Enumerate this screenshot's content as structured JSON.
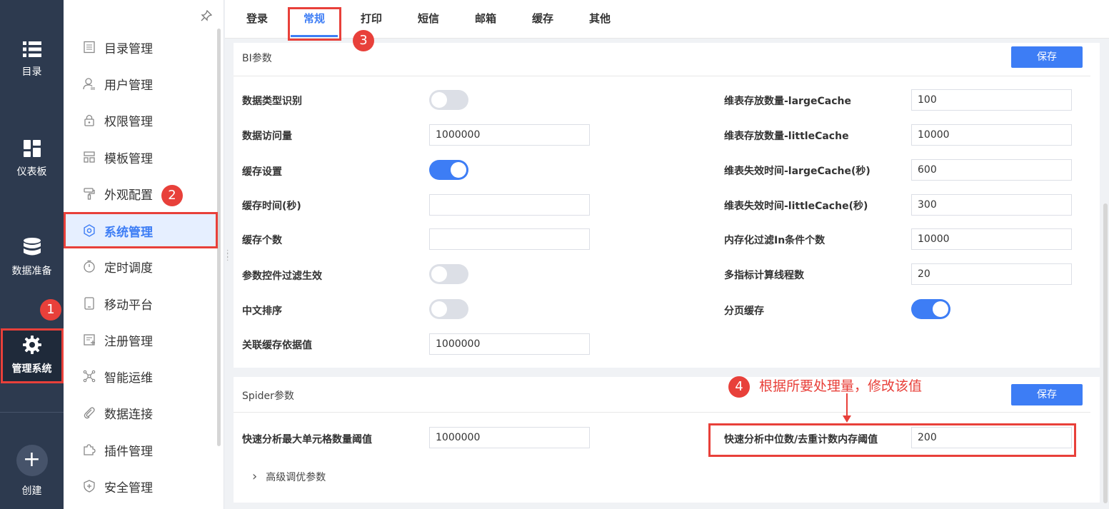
{
  "rail": {
    "items": [
      {
        "label": "目录",
        "icon": "list-icon"
      },
      {
        "label": "仪表板",
        "icon": "dashboard-icon"
      },
      {
        "label": "数据准备",
        "icon": "database-icon"
      },
      {
        "label": "管理系统",
        "icon": "gear-icon"
      }
    ],
    "create": {
      "label": "创建",
      "icon": "plus-icon",
      "glyph": "+"
    }
  },
  "menu": {
    "items": [
      {
        "label": "目录管理",
        "icon": "catalog-icon"
      },
      {
        "label": "用户管理",
        "icon": "user-icon"
      },
      {
        "label": "权限管理",
        "icon": "lock-icon"
      },
      {
        "label": "模板管理",
        "icon": "template-icon"
      },
      {
        "label": "外观配置",
        "icon": "paint-roller-icon"
      },
      {
        "label": "系统管理",
        "icon": "settings-icon"
      },
      {
        "label": "定时调度",
        "icon": "timer-icon"
      },
      {
        "label": "移动平台",
        "icon": "tablet-icon"
      },
      {
        "label": "注册管理",
        "icon": "register-icon"
      },
      {
        "label": "智能运维",
        "icon": "network-icon"
      },
      {
        "label": "数据连接",
        "icon": "paperclip-icon"
      },
      {
        "label": "插件管理",
        "icon": "puzzle-icon"
      },
      {
        "label": "安全管理",
        "icon": "shield-icon"
      }
    ]
  },
  "tabs": [
    "登录",
    "常规",
    "打印",
    "短信",
    "邮箱",
    "缓存",
    "其他"
  ],
  "bi": {
    "title": "BI参数",
    "save": "保存",
    "left": [
      {
        "label": "数据类型识别",
        "type": "toggle",
        "on": false
      },
      {
        "label": "数据访问量",
        "type": "input",
        "value": "1000000"
      },
      {
        "label": "缓存设置",
        "type": "toggle",
        "on": true
      },
      {
        "label": "缓存时间(秒)",
        "type": "input",
        "value": ""
      },
      {
        "label": "缓存个数",
        "type": "input",
        "value": ""
      },
      {
        "label": "参数控件过滤生效",
        "type": "toggle",
        "on": false
      },
      {
        "label": "中文排序",
        "type": "toggle",
        "on": false
      },
      {
        "label": "关联缓存依据值",
        "type": "input",
        "value": "1000000"
      }
    ],
    "right": [
      {
        "label": "维表存放数量-largeCache",
        "type": "input",
        "value": "100"
      },
      {
        "label": "维表存放数量-littleCache",
        "type": "input",
        "value": "10000"
      },
      {
        "label": "维表失效时间-largeCache(秒)",
        "type": "input",
        "value": "600"
      },
      {
        "label": "维表失效时间-littleCache(秒)",
        "type": "input",
        "value": "300"
      },
      {
        "label": "内存化过滤In条件个数",
        "type": "input",
        "value": "10000"
      },
      {
        "label": "多指标计算线程数",
        "type": "input",
        "value": "20"
      },
      {
        "label": "分页缓存",
        "type": "toggle",
        "on": true
      }
    ]
  },
  "spider": {
    "title": "Spider参数",
    "save": "保存",
    "left_label": "快速分析最大单元格数量阈值",
    "left_value": "1000000",
    "right_label": "快速分析中位数/去重计数内存阈值",
    "right_value": "200",
    "advanced": "高级调优参数",
    "advanced_chevron": "›"
  },
  "annotations": {
    "badges": [
      "1",
      "2",
      "3",
      "4"
    ],
    "note": "根据所要处理量，修改该值",
    "color": "#e8403a"
  },
  "colors": {
    "accent": "#3d7df5",
    "rail_bg": "#2d3a4f"
  }
}
